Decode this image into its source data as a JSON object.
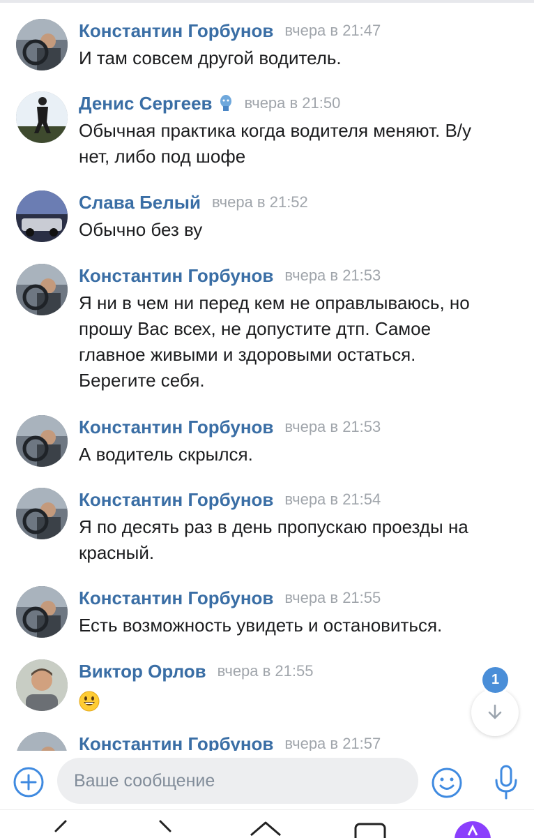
{
  "messages": [
    {
      "author": "Константин Горбунов",
      "time": "вчера в 21:47",
      "lines": [
        "И там совсем другой водитель."
      ]
    },
    {
      "author": "Денис Сергеев",
      "time": "вчера в 21:50",
      "lines": [
        "Обычная практика когда водителя меняют. В/у",
        "нет, либо под шофе"
      ]
    },
    {
      "author": "Слава Белый",
      "time": "вчера в 21:52",
      "lines": [
        "Обычно без ву"
      ]
    },
    {
      "author": "Константин Горбунов",
      "time": "вчера в 21:53",
      "lines": [
        "Я ни в чем ни перед кем не оправлываюсь, но",
        "прошу Вас всех, не допустите дтп. Самое",
        "главное живыми и здоровыми остаться.",
        "Берегите себя."
      ]
    },
    {
      "author": "Константин Горбунов",
      "time": "вчера в 21:53",
      "lines": [
        "А водитель скрылся."
      ]
    },
    {
      "author": "Константин Горбунов",
      "time": "вчера в 21:54",
      "lines": [
        "Я по десять раз в день пропускаю проезды на",
        "красный."
      ]
    },
    {
      "author": "Константин Горбунов",
      "time": "вчера в 21:55",
      "lines": [
        "Есть возможность увидеть и остановиться."
      ]
    },
    {
      "author": "Виктор Орлов",
      "time": "вчера в 21:55",
      "emoji": "grinning-face"
    },
    {
      "author": "Константин Горбунов",
      "time": "вчера в 21:57",
      "lines": []
    }
  ],
  "unread_count": "1",
  "composer": {
    "placeholder": "Ваше сообщение"
  },
  "colors": {
    "accent": "#3a6ea5",
    "badge": "#4a8ed8",
    "muted": "#a0a5ab",
    "input_bg": "#edeef0"
  },
  "icons": {
    "add": "plus-circle-icon",
    "emoji": "smile-icon",
    "mic": "microphone-icon",
    "scroll_down": "arrow-down-icon",
    "verified": "blue-badge-icon"
  }
}
